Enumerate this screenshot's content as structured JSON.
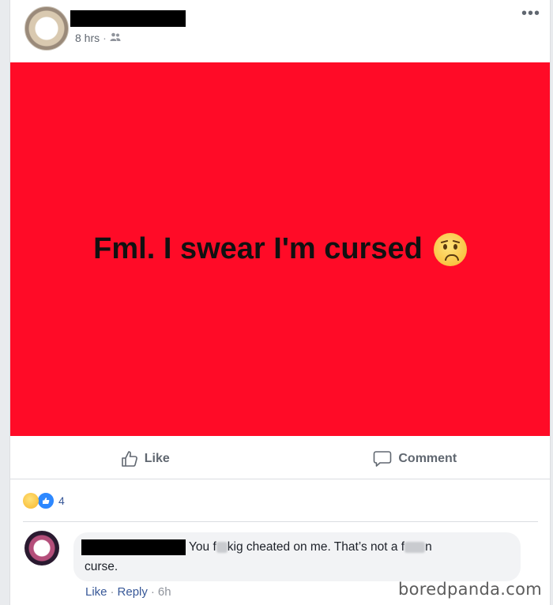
{
  "post": {
    "time": "8 hrs",
    "separator": "·",
    "audience_icon": "friends-icon",
    "more_label": "•••",
    "image_text": "Fml. I swear I'm cursed",
    "image_emoji": "worried-face-emoji",
    "image_bg_color": "#ff0b27"
  },
  "actions": {
    "like_label": "Like",
    "comment_label": "Comment"
  },
  "reactions": {
    "icons": [
      "sad-reaction-icon",
      "like-reaction-icon"
    ],
    "count": "4"
  },
  "comment": {
    "text_part1": "You f",
    "text_part2": "kig cheated on me. That’s not a f",
    "text_part3": "n",
    "text_line2": "curse.",
    "like_label": "Like",
    "reply_label": "Reply",
    "time": "6h",
    "sep": "·"
  },
  "watermark": "boredpanda.com"
}
